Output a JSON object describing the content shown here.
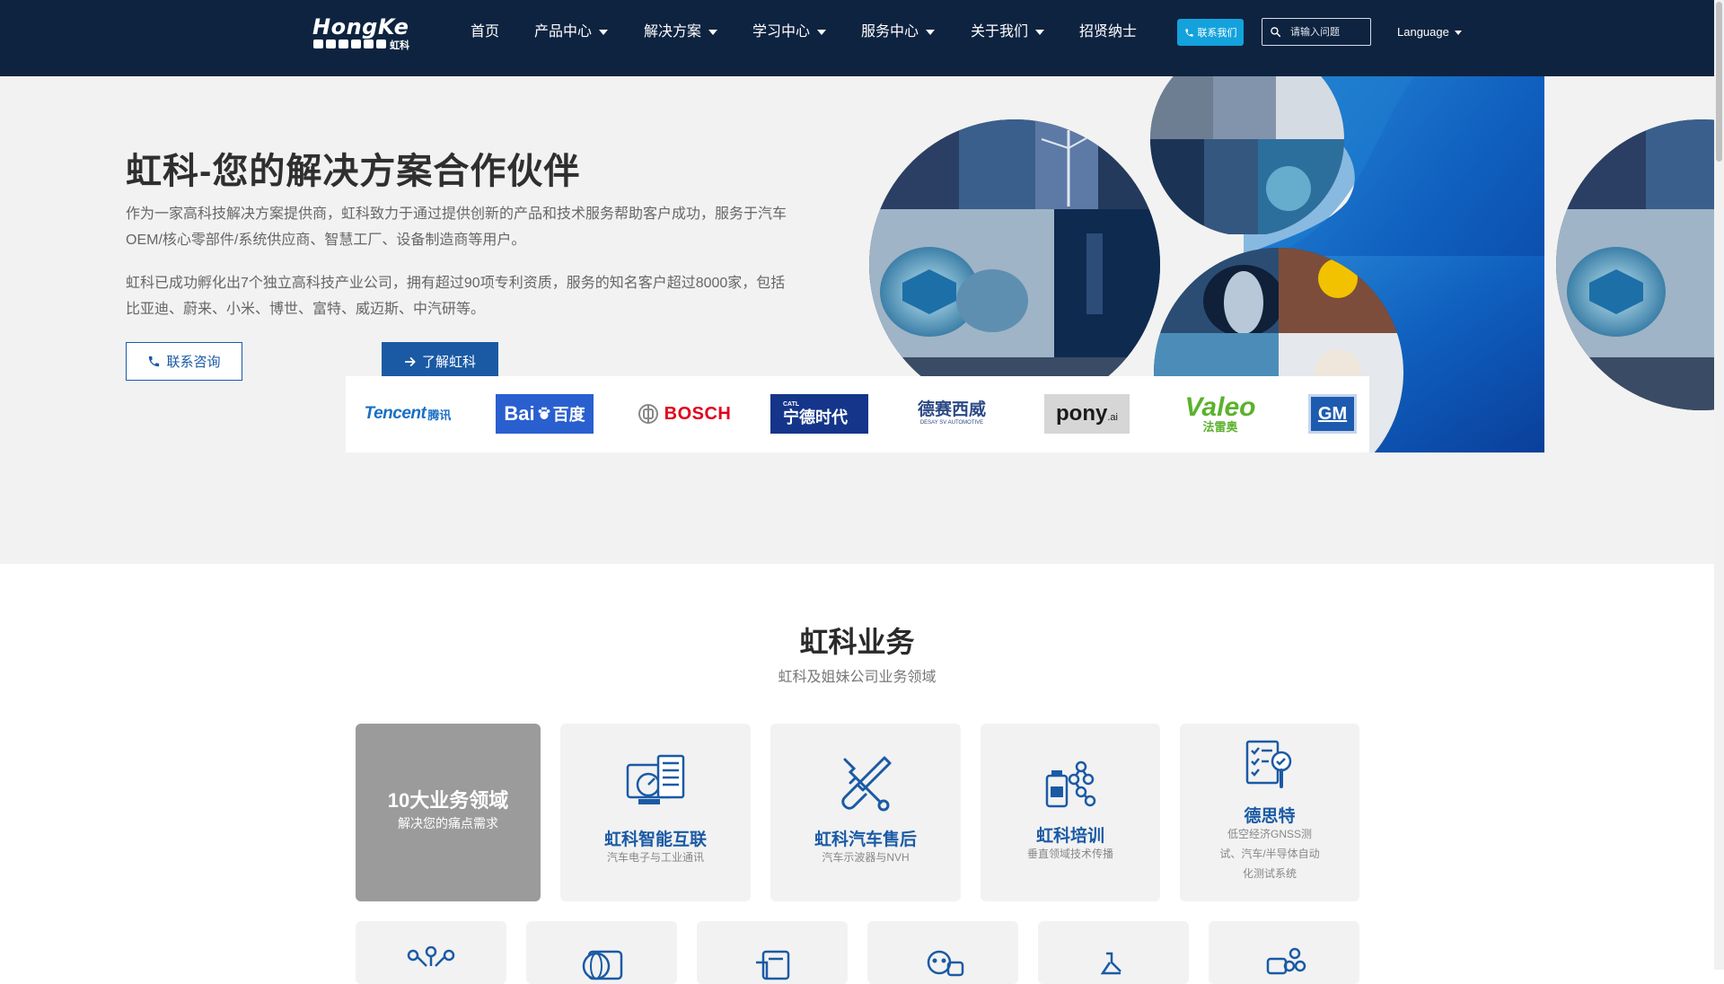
{
  "nav": {
    "logo_text": "HongKe",
    "logo_cn": "虹科",
    "items": [
      "首页",
      "产品中心",
      "解决方案",
      "学习中心",
      "服务中心",
      "关于我们",
      "招贤纳士"
    ],
    "contact_btn": "联系我们",
    "search_placeholder": "请输入问题",
    "language": "Language"
  },
  "hero": {
    "title": "虹科-您的解决方案合作伙伴",
    "p1": "作为一家高科技解决方案提供商，虹科致力于通过提供创新的产品和技术服务帮助客户成功，服务于汽车OEM/核心零部件/系统供应商、智慧工厂、设备制造商等用户。",
    "p2": "虹科已成功孵化出7个独立高科技产业公司，拥有超过90项专利资质，服务的知名客户超过8000家，包括比亚迪、蔚来、小米、博世、富特、威迈斯、中汽研等。",
    "btn_consult": "联系咨询",
    "btn_learn": "了解虹科"
  },
  "partners": {
    "tencent": "Tencent",
    "tencent_cn": "腾讯",
    "baidu": "Bai",
    "baidu_cn": "百度",
    "bosch": "BOSCH",
    "catl": "CATL",
    "catl_cn": "宁德时代",
    "desay_cn": "德赛西威",
    "desay_en": "DESAY SV AUTOMOTIVE",
    "pony": "pony",
    "pony_ai": ".ai",
    "valeo": "Valeo",
    "valeo_cn": "法雷奥",
    "gm": "GM"
  },
  "section": {
    "title": "虹科业务",
    "subtitle": "虹科及姐妹公司业务领域"
  },
  "cards": [
    {
      "title": "10大业务领域",
      "sub": "解决您的痛点需求"
    },
    {
      "title": "虹科智能互联",
      "sub": "汽车电子与工业通讯"
    },
    {
      "title": "虹科汽车售后",
      "sub": "汽车示波器与NVH"
    },
    {
      "title": "虹科培训",
      "sub": "垂直领域技术传播"
    },
    {
      "title": "德思特",
      "sub": "低空经济GNSS测试、汽车/半导体自动化测试系统"
    }
  ],
  "colors": {
    "nav_bg": "#0e2340",
    "accent_blue": "#1a5aa5",
    "contact_btn": "#14a2dc",
    "hero_bg": "#f2f2f2"
  }
}
